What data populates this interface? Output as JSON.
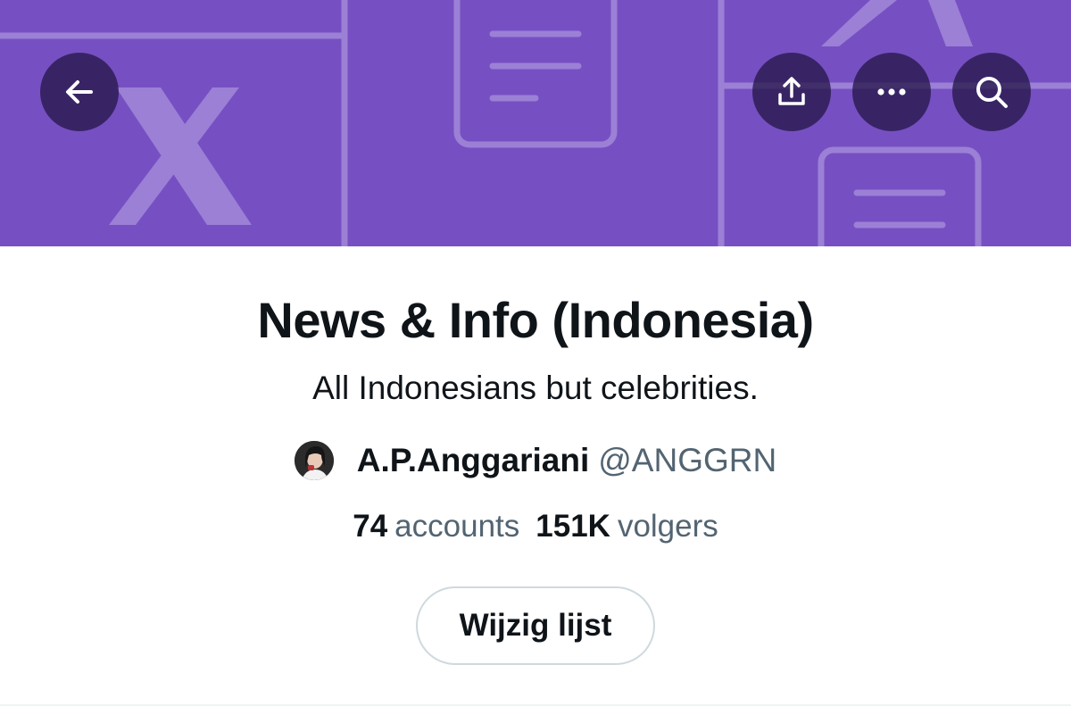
{
  "header": {
    "banner_color": "#7650c2",
    "buttons": [
      {
        "name": "back",
        "icon": "arrow-left-icon"
      },
      {
        "name": "share",
        "icon": "share-icon"
      },
      {
        "name": "more",
        "icon": "more-horizontal-icon"
      },
      {
        "name": "search",
        "icon": "search-icon"
      }
    ]
  },
  "list": {
    "title": "News & Info (Indonesia)",
    "description": "All Indonesians but celebrities."
  },
  "owner": {
    "name": "A.P.Anggariani",
    "handle": "@ANGGRN"
  },
  "stats": {
    "accounts_count": "74",
    "accounts_label": "accounts",
    "followers_count": "151K",
    "followers_label": "volgers"
  },
  "actions": {
    "edit_label": "Wijzig lijst"
  }
}
